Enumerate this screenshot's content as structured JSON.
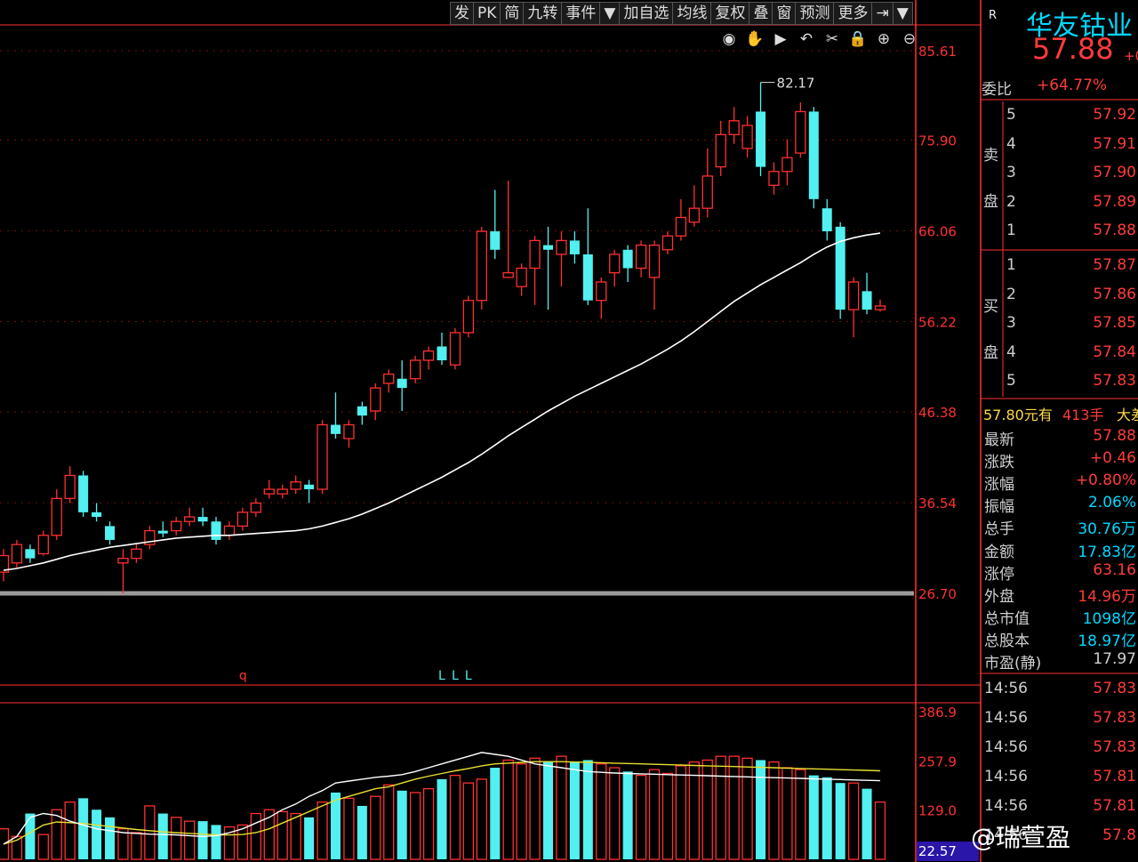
{
  "colors": {
    "up": "#ff3030",
    "down": "#52f0f0",
    "ma": "#ffffff",
    "vol_ma5": "#ffffff",
    "vol_ma10": "#e8e030",
    "axis": "#ff3030",
    "panel_label": "#cfcfcf"
  },
  "toolbar": [
    {
      "label": "发"
    },
    {
      "label": "PK"
    },
    {
      "label": "简"
    },
    {
      "label": "九转"
    },
    {
      "label": "事件"
    },
    {
      "label": "▼"
    },
    {
      "label": "加自选"
    },
    {
      "label": "均线"
    },
    {
      "label": "复权"
    },
    {
      "label": "叠"
    },
    {
      "label": "窗"
    },
    {
      "label": "预测"
    },
    {
      "label": "更多"
    },
    {
      "label": "⇥"
    },
    {
      "label": "▼"
    }
  ],
  "tool_icons": [
    "eye-icon",
    "hand-icon",
    "play-icon",
    "undo-icon",
    "scissors-icon",
    "lock-icon",
    "zoom-in-icon",
    "zoom-out-icon"
  ],
  "panel": {
    "badge": "R",
    "stock_name": "华友钴业",
    "price": "57.88",
    "price_change_partial": "+0",
    "weibi_label": "委比",
    "weibi_value": "+64.77%",
    "sell_label_1": "卖",
    "sell_label_2": "盘",
    "buy_label_1": "买",
    "buy_label_2": "盘",
    "sell": [
      {
        "level": "5",
        "price": "57.92"
      },
      {
        "level": "4",
        "price": "57.91"
      },
      {
        "level": "3",
        "price": "57.90"
      },
      {
        "level": "2",
        "price": "57.89"
      },
      {
        "level": "1",
        "price": "57.88"
      }
    ],
    "buy": [
      {
        "level": "1",
        "price": "57.87"
      },
      {
        "level": "2",
        "price": "57.86"
      },
      {
        "level": "3",
        "price": "57.85"
      },
      {
        "level": "4",
        "price": "57.84"
      },
      {
        "level": "5",
        "price": "57.83"
      }
    ],
    "order_line": {
      "price": "57.80元有",
      "qty": "413手",
      "tail": "大差"
    },
    "stats": [
      {
        "label": "最新",
        "value": "57.88",
        "color": "red"
      },
      {
        "label": "涨跌",
        "value": "+0.46",
        "color": "red"
      },
      {
        "label": "涨幅",
        "value": "+0.80%",
        "color": "red"
      },
      {
        "label": "振幅",
        "value": "2.06%",
        "color": "cyan"
      },
      {
        "label": "总手",
        "value": "30.76万",
        "color": "cyan"
      },
      {
        "label": "金额",
        "value": "17.83亿",
        "color": "cyan"
      },
      {
        "label": "涨停",
        "value": "63.16",
        "color": "red"
      },
      {
        "label": "外盘",
        "value": "14.96万",
        "color": "red"
      },
      {
        "label": "总市值",
        "value": "1098亿",
        "color": "cyan"
      },
      {
        "label": "总股本",
        "value": "18.97亿",
        "color": "cyan"
      },
      {
        "label": "市盈(静)",
        "value": "17.97",
        "color": "grey"
      }
    ],
    "ticks": [
      {
        "time": "14:56",
        "price": "57.83"
      },
      {
        "time": "14:56",
        "price": "57.83"
      },
      {
        "time": "14:56",
        "price": "57.83"
      },
      {
        "time": "14:56",
        "price": "57.81"
      },
      {
        "time": "14:56",
        "price": "57.81"
      },
      {
        "time": "14:56",
        "price": "57.8"
      }
    ]
  },
  "watermark": "@瑞萱盈",
  "chart_data": [
    {
      "type": "candlestick",
      "y_axis_labels": [
        "85.61",
        "75.90",
        "66.06",
        "56.22",
        "46.38",
        "36.54",
        "26.70"
      ],
      "ylim": [
        26.7,
        85.61
      ],
      "high_annotation": "82.17",
      "reference_line": 26.7,
      "markers": [
        {
          "text": "q",
          "index": 18
        },
        {
          "text": "L",
          "index": 33
        },
        {
          "text": "L",
          "index": 34
        },
        {
          "text": "L",
          "index": 35
        }
      ],
      "candles": [
        [
          29.0,
          30.8,
          31.5,
          28.0
        ],
        [
          30.0,
          32.0,
          32.5,
          29.5
        ],
        [
          31.5,
          30.5,
          32.0,
          30.0
        ],
        [
          31.0,
          33.0,
          33.5,
          30.8
        ],
        [
          33.0,
          37.0,
          38.0,
          32.5
        ],
        [
          37.0,
          39.5,
          40.5,
          36.5
        ],
        [
          39.5,
          35.5,
          40.0,
          35.0
        ],
        [
          35.5,
          35.0,
          36.5,
          34.5
        ],
        [
          34.0,
          32.5,
          34.5,
          32.0
        ],
        [
          30.0,
          30.5,
          31.5,
          26.7
        ],
        [
          30.5,
          31.5,
          32.0,
          30.0
        ],
        [
          32.0,
          33.5,
          34.0,
          31.5
        ],
        [
          33.5,
          33.2,
          34.5,
          32.8
        ],
        [
          33.5,
          34.5,
          35.0,
          33.0
        ],
        [
          34.5,
          35.0,
          36.0,
          34.0
        ],
        [
          35.0,
          34.5,
          36.0,
          34.0
        ],
        [
          34.5,
          32.5,
          35.0,
          32.0
        ],
        [
          33.0,
          34.0,
          34.5,
          32.5
        ],
        [
          34.0,
          35.5,
          36.0,
          33.5
        ],
        [
          35.5,
          36.5,
          37.0,
          35.0
        ],
        [
          37.5,
          38.0,
          39.0,
          37.0
        ],
        [
          37.5,
          38.0,
          38.5,
          37.0
        ],
        [
          38.0,
          38.8,
          39.5,
          37.5
        ],
        [
          38.5,
          38.0,
          39.0,
          36.5
        ],
        [
          38.0,
          45.0,
          45.5,
          37.5
        ],
        [
          45.0,
          44.0,
          48.5,
          43.5
        ],
        [
          43.5,
          45.0,
          45.5,
          42.5
        ],
        [
          47.0,
          46.0,
          47.5,
          45.0
        ],
        [
          46.5,
          49.0,
          49.5,
          45.5
        ],
        [
          49.5,
          50.5,
          51.0,
          48.5
        ],
        [
          50.0,
          49.0,
          52.0,
          46.5
        ],
        [
          50.0,
          52.0,
          52.5,
          49.5
        ],
        [
          52.0,
          53.0,
          53.5,
          51.0
        ],
        [
          53.5,
          52.0,
          55.0,
          51.5
        ],
        [
          51.5,
          55.0,
          55.5,
          51.0
        ],
        [
          55.0,
          58.5,
          59.0,
          54.5
        ],
        [
          58.5,
          66.0,
          66.5,
          57.5
        ],
        [
          66.0,
          64.0,
          70.5,
          63.0
        ],
        [
          61.0,
          61.5,
          71.5,
          61.0
        ],
        [
          60.0,
          62.0,
          62.5,
          59.0
        ],
        [
          62.0,
          65.0,
          65.5,
          58.0
        ],
        [
          64.5,
          64.0,
          66.5,
          57.5
        ],
        [
          63.5,
          65.0,
          66.0,
          60.0
        ],
        [
          65.0,
          63.5,
          66.0,
          62.5
        ],
        [
          63.5,
          58.5,
          68.5,
          58.0
        ],
        [
          58.5,
          60.5,
          61.0,
          56.5
        ],
        [
          61.5,
          63.5,
          64.0,
          60.0
        ],
        [
          64.0,
          62.0,
          64.5,
          60.5
        ],
        [
          62.0,
          64.5,
          65.0,
          61.0
        ],
        [
          61.0,
          64.5,
          65.0,
          57.5
        ],
        [
          64.0,
          65.5,
          66.0,
          63.5
        ],
        [
          65.5,
          67.5,
          69.5,
          65.0
        ],
        [
          67.0,
          68.5,
          71.0,
          66.5
        ],
        [
          68.5,
          72.0,
          75.0,
          67.5
        ],
        [
          73.0,
          76.5,
          78.0,
          72.0
        ],
        [
          76.5,
          78.0,
          79.5,
          75.5
        ],
        [
          75.0,
          77.5,
          78.5,
          74.0
        ],
        [
          79.0,
          73.0,
          82.17,
          72.0
        ],
        [
          71.0,
          72.5,
          73.5,
          70.0
        ],
        [
          72.5,
          74.0,
          76.0,
          71.0
        ],
        [
          74.5,
          79.0,
          80.0,
          74.0
        ],
        [
          79.0,
          69.5,
          79.5,
          68.5
        ],
        [
          68.5,
          66.0,
          69.5,
          65.0
        ],
        [
          66.5,
          57.5,
          67.0,
          56.5
        ],
        [
          57.5,
          60.5,
          61.0,
          54.5
        ],
        [
          59.5,
          57.5,
          61.5,
          57.0
        ],
        [
          57.5,
          57.9,
          58.6,
          57.3
        ]
      ],
      "ma_line": [
        29.2,
        29.4,
        29.7,
        30.0,
        30.4,
        30.8,
        31.1,
        31.4,
        31.7,
        31.9,
        32.1,
        32.3,
        32.5,
        32.7,
        32.8,
        32.9,
        33.0,
        33.0,
        33.1,
        33.2,
        33.3,
        33.4,
        33.5,
        33.7,
        34.0,
        34.4,
        34.8,
        35.3,
        35.9,
        36.5,
        37.2,
        37.9,
        38.6,
        39.3,
        40.1,
        40.9,
        41.8,
        42.8,
        43.8,
        44.7,
        45.6,
        46.5,
        47.3,
        48.1,
        48.8,
        49.5,
        50.2,
        50.9,
        51.6,
        52.4,
        53.2,
        54.1,
        55.1,
        56.2,
        57.3,
        58.4,
        59.3,
        60.2,
        61.0,
        61.8,
        62.6,
        63.5,
        64.3,
        64.9,
        65.3,
        65.6,
        65.8
      ]
    },
    {
      "type": "bar",
      "y_axis_labels": [
        "386.9",
        "257.9",
        "129.0",
        "22.57"
      ],
      "ylim": [
        0,
        386.9
      ],
      "volume": [
        80,
        60,
        120,
        65,
        130,
        150,
        160,
        130,
        110,
        80,
        70,
        140,
        120,
        110,
        100,
        100,
        90,
        85,
        90,
        120,
        130,
        125,
        120,
        110,
        150,
        175,
        160,
        140,
        165,
        195,
        180,
        175,
        185,
        210,
        220,
        200,
        210,
        240,
        260,
        250,
        265,
        255,
        270,
        255,
        260,
        250,
        240,
        230,
        220,
        235,
        225,
        245,
        255,
        260,
        270,
        270,
        265,
        260,
        255,
        240,
        235,
        220,
        215,
        200,
        200,
        185,
        150
      ],
      "vol_ma5": [
        40,
        60,
        110,
        120,
        115,
        100,
        90,
        80,
        75,
        70,
        68,
        66,
        65,
        64,
        62,
        60,
        62,
        70,
        80,
        95,
        110,
        130,
        145,
        165,
        180,
        200,
        205,
        210,
        215,
        218,
        222,
        230,
        240,
        250,
        260,
        270,
        280,
        275,
        270,
        260,
        250,
        245,
        240,
        235,
        230,
        228,
        226,
        225,
        224,
        223,
        222,
        221,
        220,
        219,
        218,
        217,
        216,
        215,
        214,
        213,
        212,
        211,
        210,
        209,
        208,
        207,
        206
      ],
      "vol_ma10": [
        40,
        50,
        70,
        90,
        98,
        96,
        94,
        90,
        86,
        82,
        78,
        75,
        72,
        70,
        68,
        66,
        64,
        64,
        65,
        70,
        80,
        95,
        110,
        125,
        140,
        155,
        165,
        175,
        185,
        190,
        200,
        210,
        218,
        225,
        232,
        238,
        245,
        250,
        252,
        254,
        256,
        256,
        256,
        255,
        254,
        253,
        252,
        251,
        250,
        249,
        248,
        247,
        246,
        245,
        244,
        243,
        242,
        241,
        240,
        239,
        238,
        237,
        236,
        235,
        234,
        233,
        232
      ]
    }
  ]
}
